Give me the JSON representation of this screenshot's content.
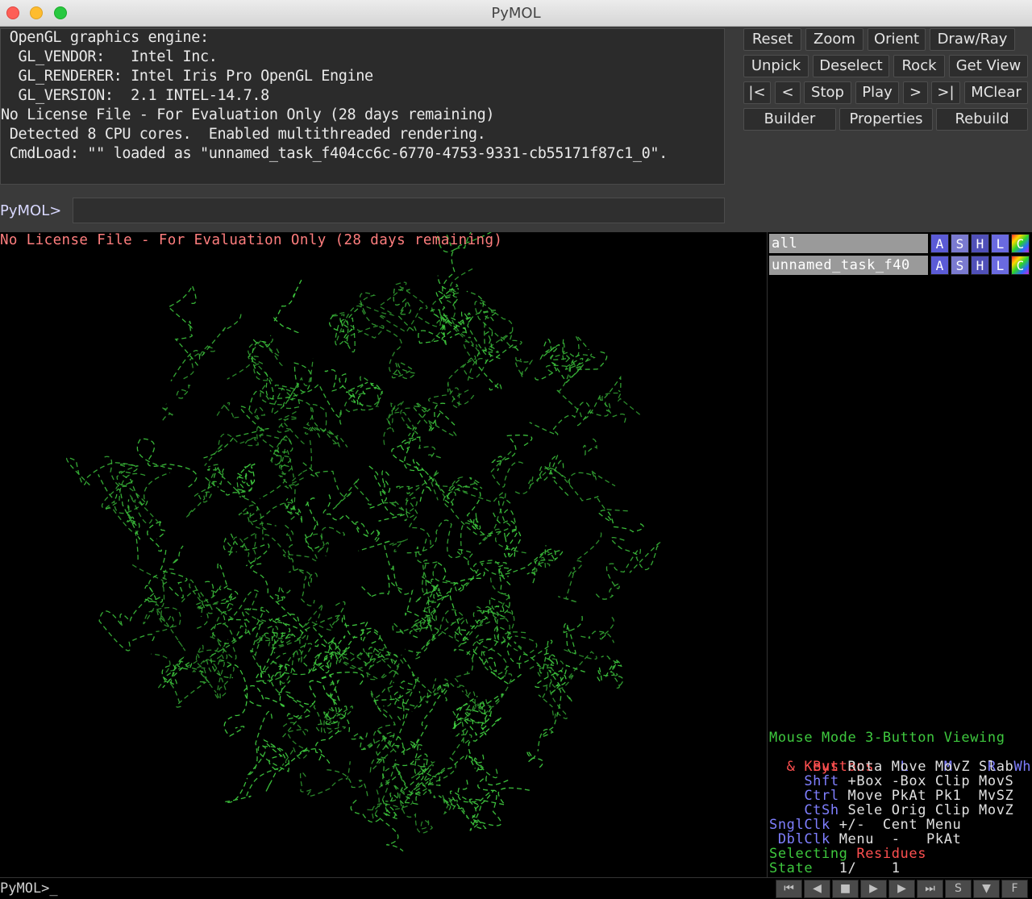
{
  "window": {
    "title": "PyMOL"
  },
  "console": {
    "lines": [
      " OpenGL graphics engine:",
      "  GL_VENDOR:   Intel Inc.",
      "  GL_RENDERER: Intel Iris Pro OpenGL Engine",
      "  GL_VERSION:  2.1 INTEL-14.7.8",
      "No License File - For Evaluation Only (28 days remaining)",
      " Detected 8 CPU cores.  Enabled multithreaded rendering.",
      " CmdLoad: \"\" loaded as \"unnamed_task_f404cc6c-6770-4753-9331-cb55171f87c1_0\"."
    ]
  },
  "command": {
    "prompt": "PyMOL>",
    "value": ""
  },
  "buttons": {
    "reset": "Reset",
    "zoom": "Zoom",
    "orient": "Orient",
    "draw_ray": "Draw/Ray",
    "unpick": "Unpick",
    "deselect": "Deselect",
    "rock": "Rock",
    "get_view": "Get View",
    "first": "|<",
    "prev": "<",
    "stop": "Stop",
    "play": "Play",
    "next": "&gt;",
    "last": ">|",
    "mclear": "MClear",
    "builder": "Builder",
    "properties": "Properties",
    "rebuild": "Rebuild"
  },
  "viewer": {
    "message": "No License File - For Evaluation Only (28 days remaining)",
    "molecule_color": "#3ec83e"
  },
  "objects": [
    {
      "name": "all",
      "buttons": [
        "A",
        "S",
        "H",
        "L",
        "C"
      ]
    },
    {
      "name": "unnamed_task_f40",
      "buttons": [
        "A",
        "S",
        "H",
        "L",
        "C"
      ]
    }
  ],
  "mouse_info": {
    "mode": "Mouse Mode 3-Button Viewing",
    "buttons_label": " Buttons",
    "col_L": "L",
    "col_M": "M",
    "col_R": "R",
    "col_Wheel": "Wheel",
    "keys_label": "  & Keys",
    "rows": [
      {
        "mod": "  & Keys",
        "vals": "Rota Move MovZ Slab"
      },
      {
        "mod": "    Shft",
        "vals": "+Box -Box Clip MovS"
      },
      {
        "mod": "    Ctrl",
        "vals": "Move PkAt Pk1  MvSZ"
      },
      {
        "mod": "    CtSh",
        "vals": "Sele Orig Clip MovZ"
      },
      {
        "mod": "SnglClk",
        "vals": " +/-  Cent Menu"
      },
      {
        "mod": " DblClk",
        "vals": " Menu  -   PkAt"
      }
    ],
    "selecting_label": "Selecting",
    "selecting_value": "Residues",
    "state_label": "State",
    "state_value": "   1/    1"
  },
  "bottom": {
    "prompt": "PyMOL>_"
  },
  "movie_controls": [
    "⏮",
    "◀",
    "■",
    "▶",
    "▶",
    "⏭",
    "S",
    "▼",
    "F"
  ],
  "colors": {
    "accent_green": "#3ec83e",
    "warn_red": "#ff7e7e",
    "label_blue": "#7f7fff",
    "label_red": "#ff5050"
  }
}
